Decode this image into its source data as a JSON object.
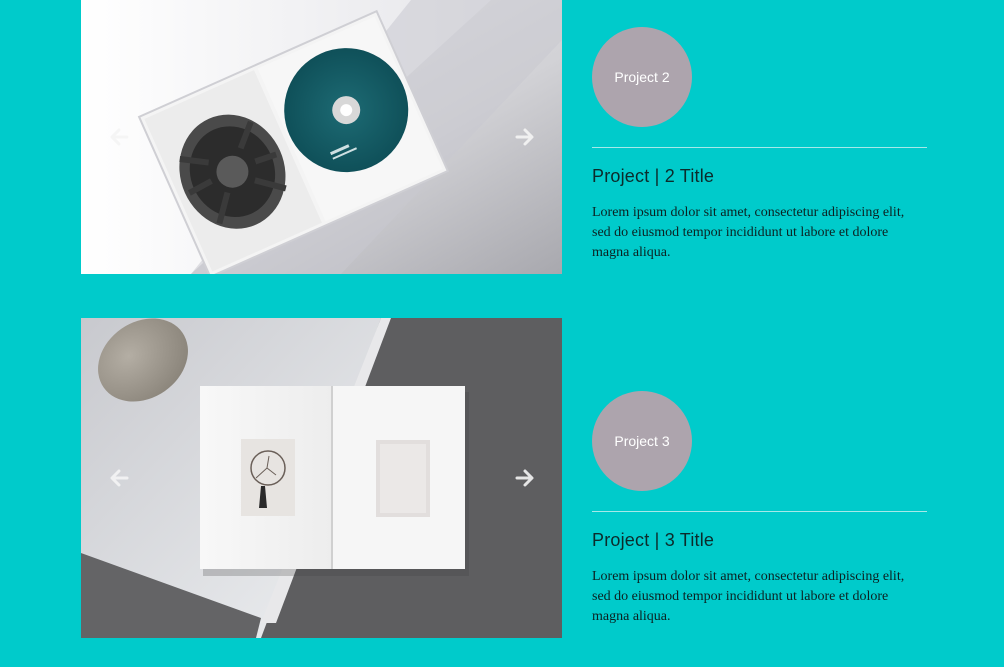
{
  "projects": [
    {
      "badge": "Project 2",
      "title": "Project | 2 Title",
      "description": "Lorem ipsum dolor sit amet, consectetur adipiscing elit, sed do eiusmod tempor incididunt ut labore et dolore magna aliqua.",
      "image": "cd-case-photo",
      "prev_icon": "arrow-left-icon",
      "next_icon": "arrow-right-icon"
    },
    {
      "badge": "Project 3",
      "title": "Project | 3 Title",
      "description": "Lorem ipsum dolor sit amet, consectetur adipiscing elit, sed do eiusmod tempor incididunt ut labore et dolore magna aliqua.",
      "image": "open-book-photo",
      "prev_icon": "arrow-left-icon",
      "next_icon": "arrow-right-icon"
    }
  ],
  "colors": {
    "page_background": "#00CBCB",
    "badge_background": "#ADA4AD",
    "divider": "#A6E9E9",
    "cd_disc": "#155E66"
  }
}
